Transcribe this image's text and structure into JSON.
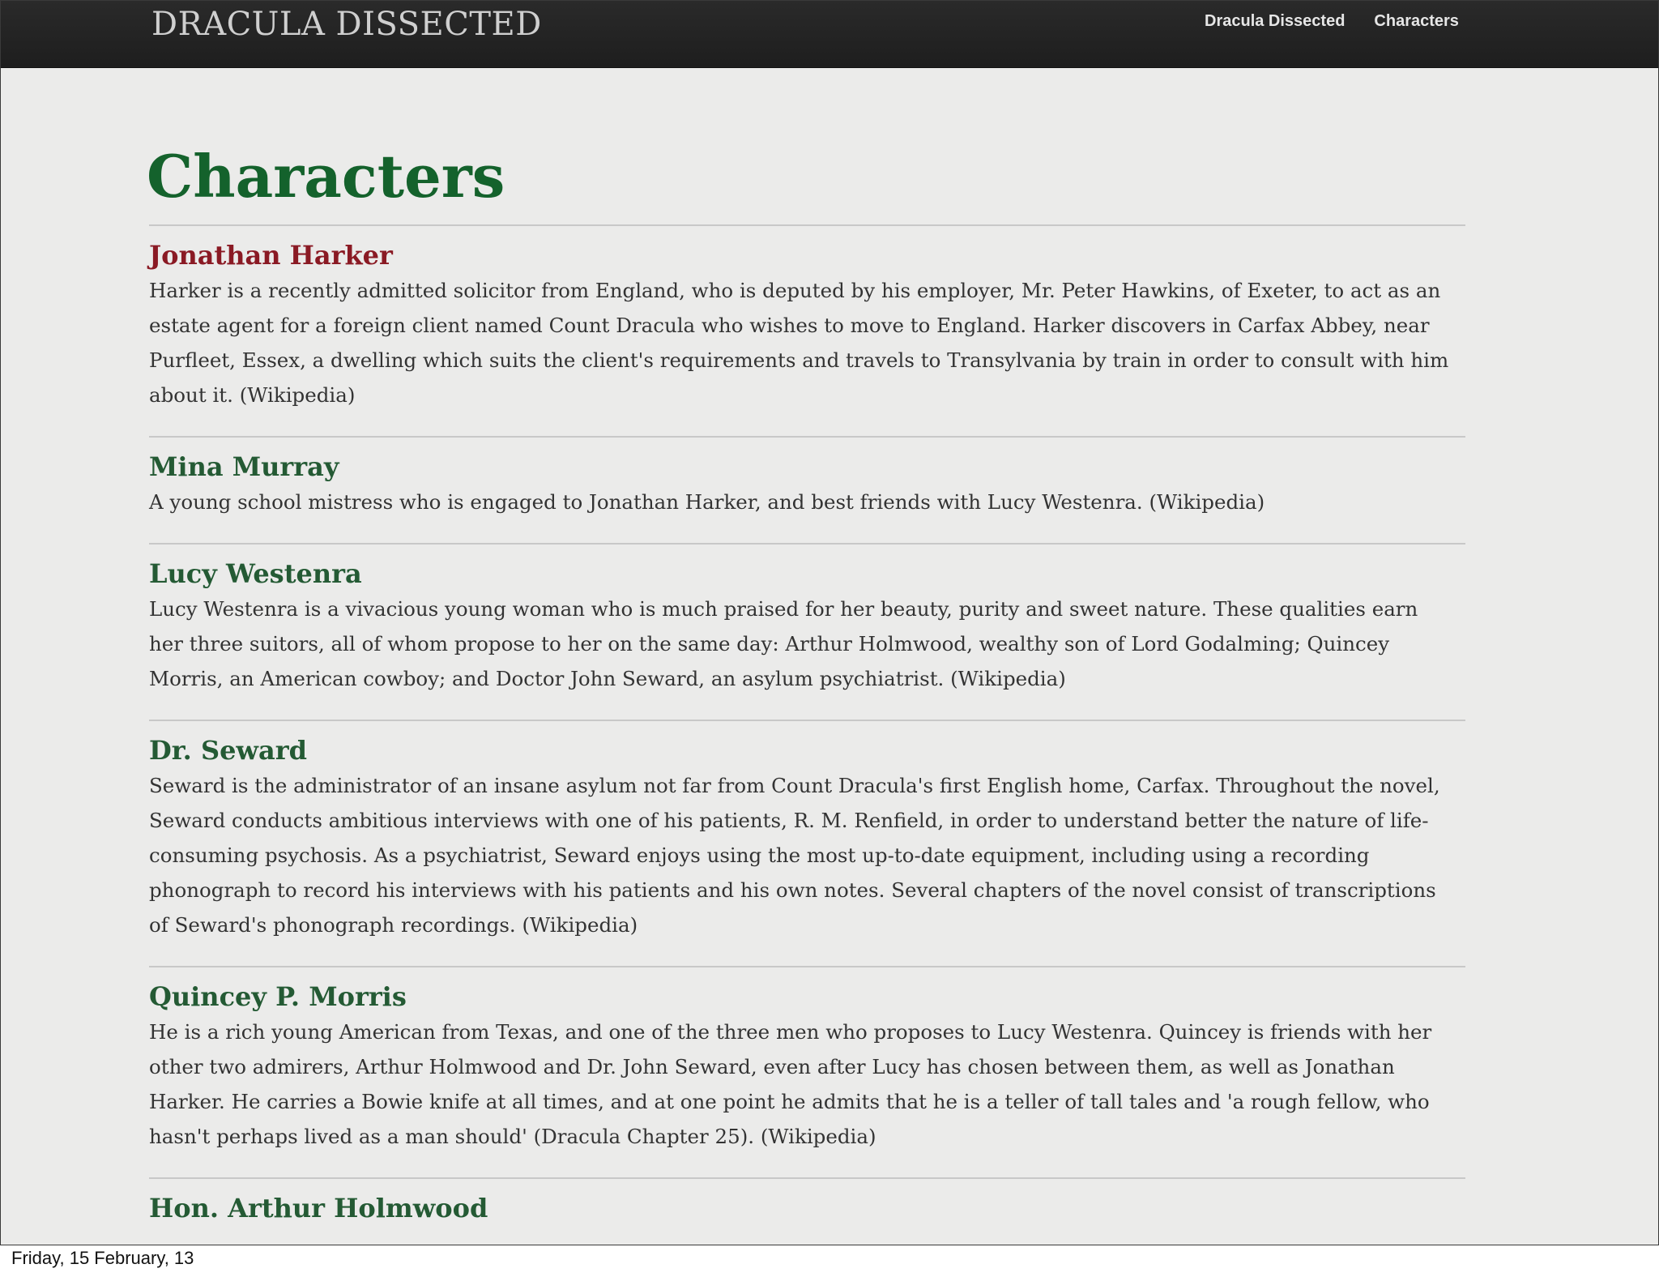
{
  "header": {
    "brand": "DRACULA DISSECTED",
    "nav": [
      {
        "label": "Dracula Dissected"
      },
      {
        "label": "Characters"
      }
    ]
  },
  "main": {
    "title": "Characters",
    "characters": [
      {
        "name": "Jonathan Harker",
        "description": "Harker is a recently admitted solicitor from England, who is deputed by his employer, Mr. Peter Hawkins, of Exeter, to act as an estate agent for a foreign client named Count Dracula who wishes to move to England. Harker discovers in Carfax Abbey, near Purfleet, Essex, a dwelling which suits the client's requirements and travels to Transylvania by train in order to consult with him about it. (Wikipedia)"
      },
      {
        "name": "Mina Murray",
        "description": "A young school mistress who is engaged to Jonathan Harker, and best friends with Lucy Westenra. (Wikipedia)"
      },
      {
        "name": "Lucy Westenra",
        "description": "Lucy Westenra is a vivacious young woman who is much praised for her beauty, purity and sweet nature. These qualities earn her three suitors, all of whom propose to her on the same day: Arthur Holmwood, wealthy son of Lord Godalming; Quincey Morris, an American cowboy; and Doctor John Seward, an asylum psychiatrist. (Wikipedia)"
      },
      {
        "name": "Dr. Seward",
        "description": "Seward is the administrator of an insane asylum not far from Count Dracula's first English home, Carfax. Throughout the novel, Seward conducts ambitious interviews with one of his patients, R. M. Renfield, in order to understand better the nature of life-consuming psychosis. As a psychiatrist, Seward enjoys using the most up-to-date equipment, including using a recording phonograph to record his interviews with his patients and his own notes. Several chapters of the novel consist of transcriptions of Seward's phonograph recordings. (Wikipedia)"
      },
      {
        "name": "Quincey P. Morris",
        "description": "He is a rich young American from Texas, and one of the three men who proposes to Lucy Westenra. Quincey is friends with her other two admirers, Arthur Holmwood and Dr. John Seward, even after Lucy has chosen between them, as well as Jonathan Harker. He carries a Bowie knife at all times, and at one point he admits that he is a teller of tall tales and 'a rough fellow, who hasn't perhaps lived as a man should' (Dracula Chapter 25). (Wikipedia)"
      },
      {
        "name": "Hon. Arthur Holmwood",
        "description": ""
      }
    ]
  },
  "footer": {
    "date": "Friday, 15 February, 13"
  },
  "colors": {
    "title_green": "#14622c",
    "active_red": "#8a1a24",
    "name_green": "#245a34",
    "topbar": "#1e1e1e"
  }
}
